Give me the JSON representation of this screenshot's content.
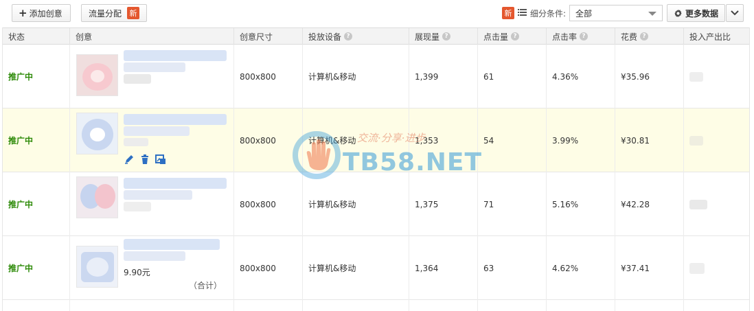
{
  "toolbar": {
    "add_creative": "添加创意",
    "traffic_allocation": "流量分配",
    "new_badge": "新",
    "segment_label": "细分条件:",
    "segment_value": "全部",
    "more_data": "更多数据"
  },
  "columns": [
    "状态",
    "创意",
    "创意尺寸",
    "投放设备",
    "展现量",
    "点击量",
    "点击率",
    "花费",
    "投入产出比"
  ],
  "rows": [
    {
      "status": "推广中",
      "size": "800x800",
      "device": "计算机&移动",
      "impressions": "1,399",
      "clicks": "61",
      "ctr": "4.36%",
      "cost": "¥35.96"
    },
    {
      "status": "推广中",
      "size": "800x800",
      "device": "计算机&移动",
      "impressions": "1,353",
      "clicks": "54",
      "ctr": "3.99%",
      "cost": "¥30.81"
    },
    {
      "status": "推广中",
      "size": "800x800",
      "device": "计算机&移动",
      "impressions": "1,375",
      "clicks": "71",
      "ctr": "5.16%",
      "cost": "¥42.28"
    },
    {
      "status": "推广中",
      "size": "800x800",
      "device": "计算机&移动",
      "impressions": "1,364",
      "clicks": "63",
      "ctr": "4.62%",
      "cost": "¥37.41",
      "price": "9.90元"
    }
  ],
  "footer": {
    "total_label": "（合计）"
  },
  "watermark": {
    "text": "TB58.NET",
    "slogan": "交流·分享·进步"
  },
  "colors": {
    "status_green": "#2d8a08",
    "highlight_row": "#fefde6",
    "badge_red": "#e4572e"
  }
}
